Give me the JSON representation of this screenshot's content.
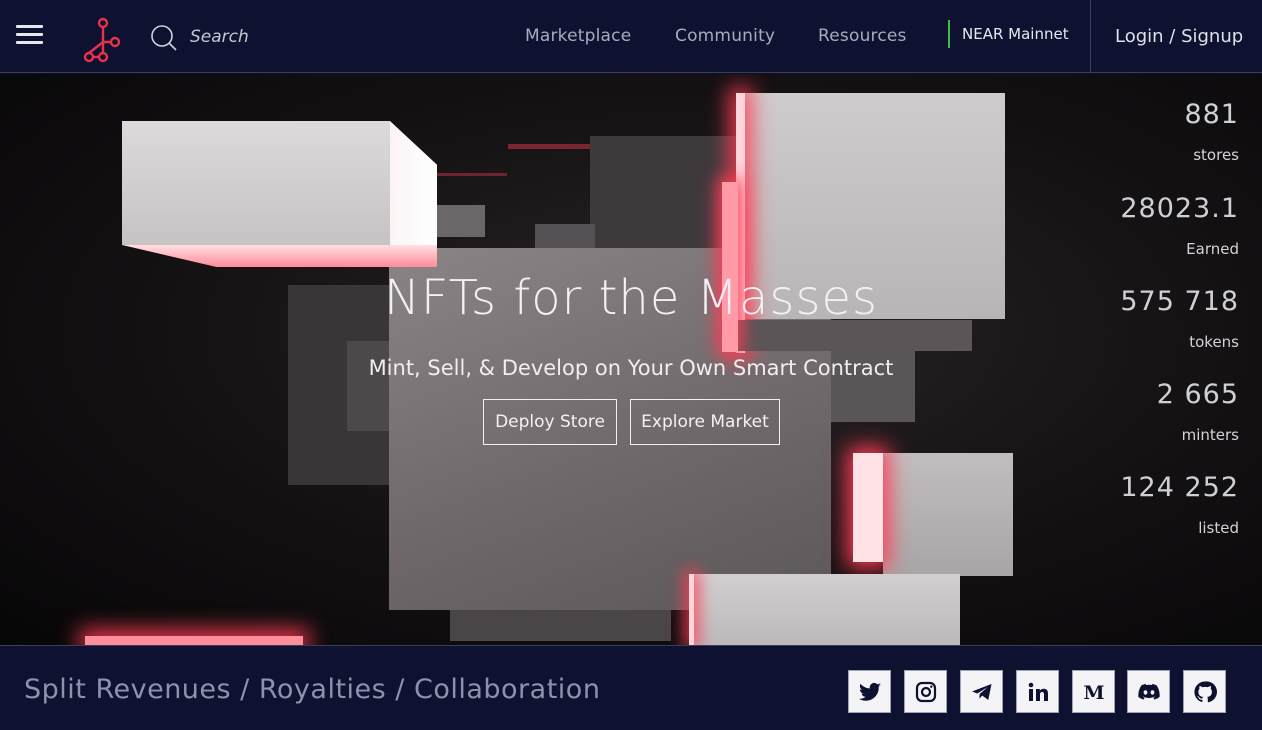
{
  "nav": {
    "search_placeholder": "Search",
    "links": [
      "Marketplace",
      "Community",
      "Resources"
    ],
    "network": "NEAR Mainnet",
    "login": "Login / Signup"
  },
  "hero": {
    "title": "NFTs for the Masses",
    "subtitle": "Mint, Sell, & Develop on Your Own Smart Contract",
    "buttons": [
      "Deploy Store",
      "Explore Market"
    ]
  },
  "stats": [
    {
      "value": "881",
      "label": "stores"
    },
    {
      "value": "28023.1",
      "label": "Earned"
    },
    {
      "value": "575 718",
      "label": "tokens"
    },
    {
      "value": "2 665",
      "label": "minters"
    },
    {
      "value": "124 252",
      "label": "listed"
    }
  ],
  "footer": {
    "tagline": "Split Revenues / Royalties / Collaboration",
    "social_icons": [
      "twitter-icon",
      "instagram-icon",
      "telegram-icon",
      "linkedin-icon",
      "medium-icon",
      "discord-icon",
      "github-icon"
    ]
  },
  "colors": {
    "nav_bg": "#0e1230",
    "accent_red": "#e8324a",
    "network_green": "#3cbf4a"
  }
}
